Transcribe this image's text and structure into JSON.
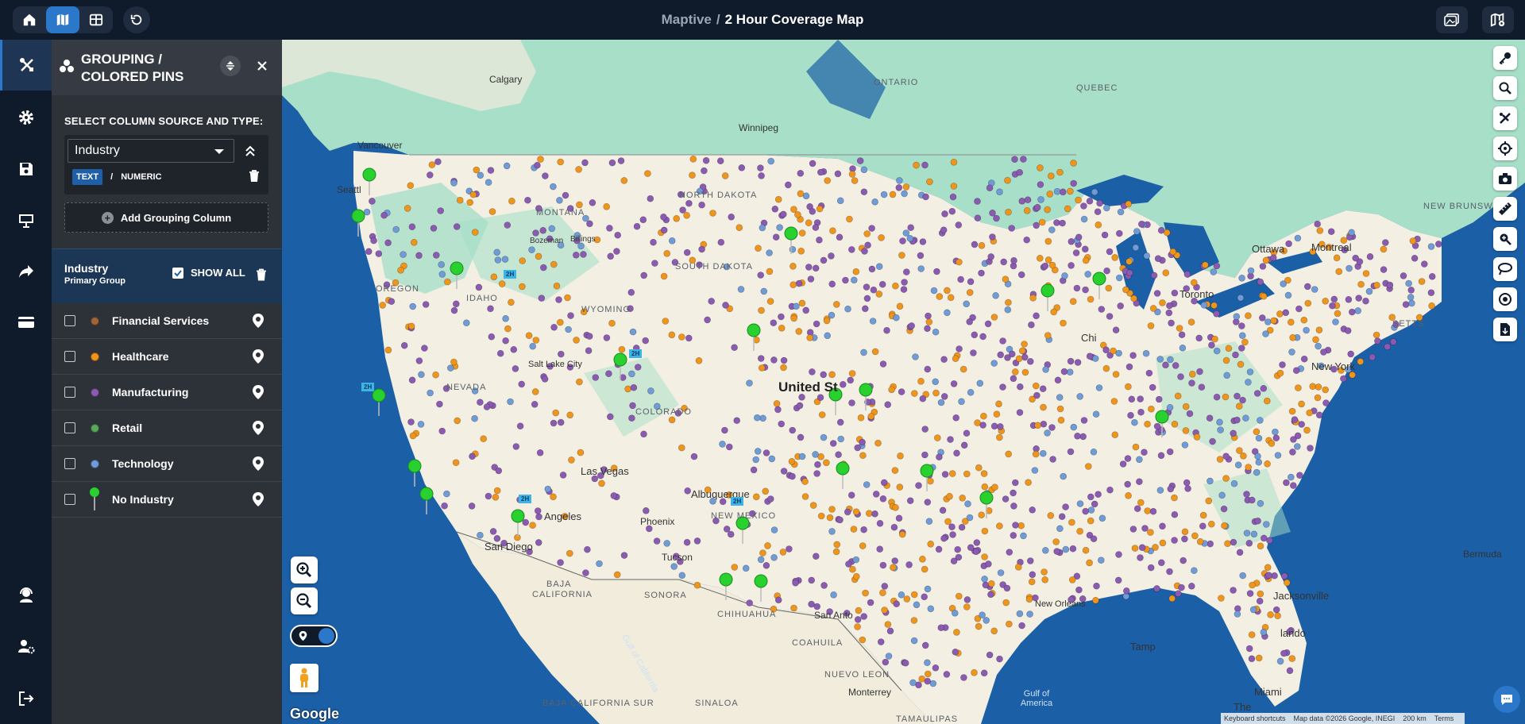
{
  "topbar": {
    "app_name": "Maptive",
    "separator": "/",
    "map_title": "2 Hour Coverage Map",
    "buttons": [
      "home-icon",
      "map-icon",
      "table-icon",
      "refresh-icon"
    ],
    "right_buttons": [
      "image-icon",
      "map-settings-icon"
    ]
  },
  "rail": {
    "items": [
      "tools-icon",
      "gear-icon",
      "save-icon",
      "presentation-icon",
      "share-icon",
      "billing-icon"
    ],
    "bottom_items": [
      "support-icon",
      "user-settings-icon",
      "logout-icon"
    ]
  },
  "panel": {
    "title_line1": "GROUPING /",
    "title_line2": "COLORED PINS",
    "select_label": "SELECT COLUMN SOURCE AND TYPE:",
    "column_value": "Industry",
    "type_text": "TEXT",
    "type_sep": "/",
    "type_numeric": "NUMERIC",
    "add_grouping": "Add Grouping Column",
    "group_name": "Industry",
    "group_sub": "Primary Group",
    "show_all": "SHOW ALL",
    "groups": [
      {
        "label": "Financial Services",
        "color": "#a0643b"
      },
      {
        "label": "Healthcare",
        "color": "#f0951c"
      },
      {
        "label": "Manufacturing",
        "color": "#8a5bb0"
      },
      {
        "label": "Retail",
        "color": "#5aa85a"
      },
      {
        "label": "Technology",
        "color": "#6f9bd6"
      },
      {
        "label": "No Industry",
        "color": "#29d12f"
      }
    ]
  },
  "map": {
    "labels": {
      "calgary": "Calgary",
      "winnipeg": "Winnipeg",
      "ontario": "ONTARIO",
      "quebec": "QUEBEC",
      "vancouver": "Vancouver",
      "seattle": "Seattl",
      "montana": "MONTANA",
      "billings": "Billings",
      "bozeman": "Bozeman",
      "north_dakota": "NORTH DAKOTA",
      "south_dakota": "SOUTH DAKOTA",
      "oregon": "OREGON",
      "idaho": "IDAHO",
      "wyoming": "WYOMING",
      "nevada": "NEVADA",
      "salt_lake": "Salt Lake City",
      "colorado": "COLORADO",
      "united_states": "United St",
      "las_vegas": "Las Vegas",
      "albuquerque": "Albuquerque",
      "new_mexico": "NEW MEXICO",
      "phoenix": "Phoenix",
      "tucson": "Tucson",
      "angeles": "Angeles",
      "san_diego": "San Diego",
      "baja": "BAJA",
      "california": "CALIFORNIA",
      "sonora": "SONORA",
      "chihuahua": "CHIHUAHUA",
      "coahuila": "COAHUILA",
      "nuevo_leon": "NUEVO LEON",
      "san_antonio": "San Anto",
      "monterrey": "Monterrey",
      "sinaloa": "SINALOA",
      "tamaulipas": "TAMAULIPAS",
      "baja_sur": "BAJA CALIFORNIA SUR",
      "gulf_cal": "Gulf of California",
      "gulf_america": "Gulf of America",
      "new_orleans": "New Orleans",
      "jacksonville": "Jacksonville",
      "orlando": "lando",
      "tampa": "Tamp",
      "miami": "Miami",
      "toronto": "Toronto",
      "ottawa": "Ottawa",
      "montreal": "Montreal",
      "new_york": "New York",
      "new_brunswick": "NEW BRUNSWICK",
      "bermuda": "Bermuda",
      "chicago": "Chi",
      "the_bahamas": "The",
      "setts": "SETTS"
    },
    "attribution": [
      "Keyboard shortcuts",
      "Map data ©2026 Google, INEGI",
      "200 km",
      "Terms"
    ],
    "google": "Google",
    "tools": [
      "key-icon",
      "search-icon",
      "route-icon",
      "locate-icon",
      "camera-icon",
      "ruler-icon",
      "zoom-search-icon",
      "lasso-icon",
      "target-icon",
      "export-icon"
    ]
  }
}
